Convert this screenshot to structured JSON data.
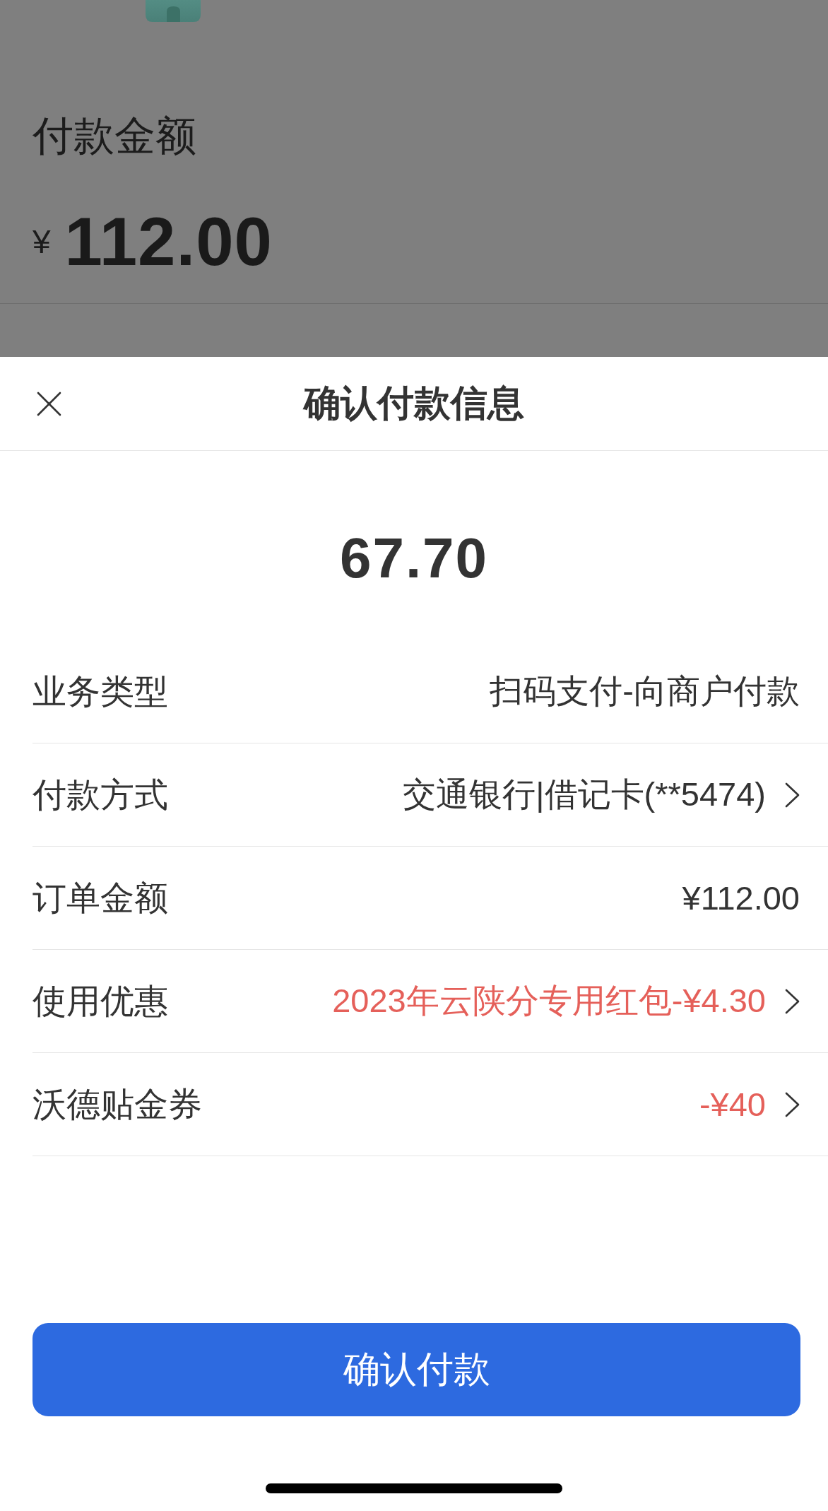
{
  "payment": {
    "label": "付款金额",
    "currency": "¥",
    "amount": "112.00"
  },
  "sheet": {
    "title": "确认付款信息",
    "amount": "67.70",
    "rows": [
      {
        "label": "业务类型",
        "value": "扫码支付-向商户付款",
        "discount": false,
        "arrow": false
      },
      {
        "label": "付款方式",
        "value": "交通银行|借记卡(**5474)",
        "discount": false,
        "arrow": true
      },
      {
        "label": "订单金额",
        "value": "¥112.00",
        "discount": false,
        "arrow": false
      },
      {
        "label": "使用优惠",
        "value": "2023年云陕分专用红包-¥4.30",
        "discount": true,
        "arrow": true
      },
      {
        "label": "沃德贴金券",
        "value": "-¥40",
        "discount": true,
        "arrow": true
      }
    ],
    "confirm_button": "确认付款"
  }
}
